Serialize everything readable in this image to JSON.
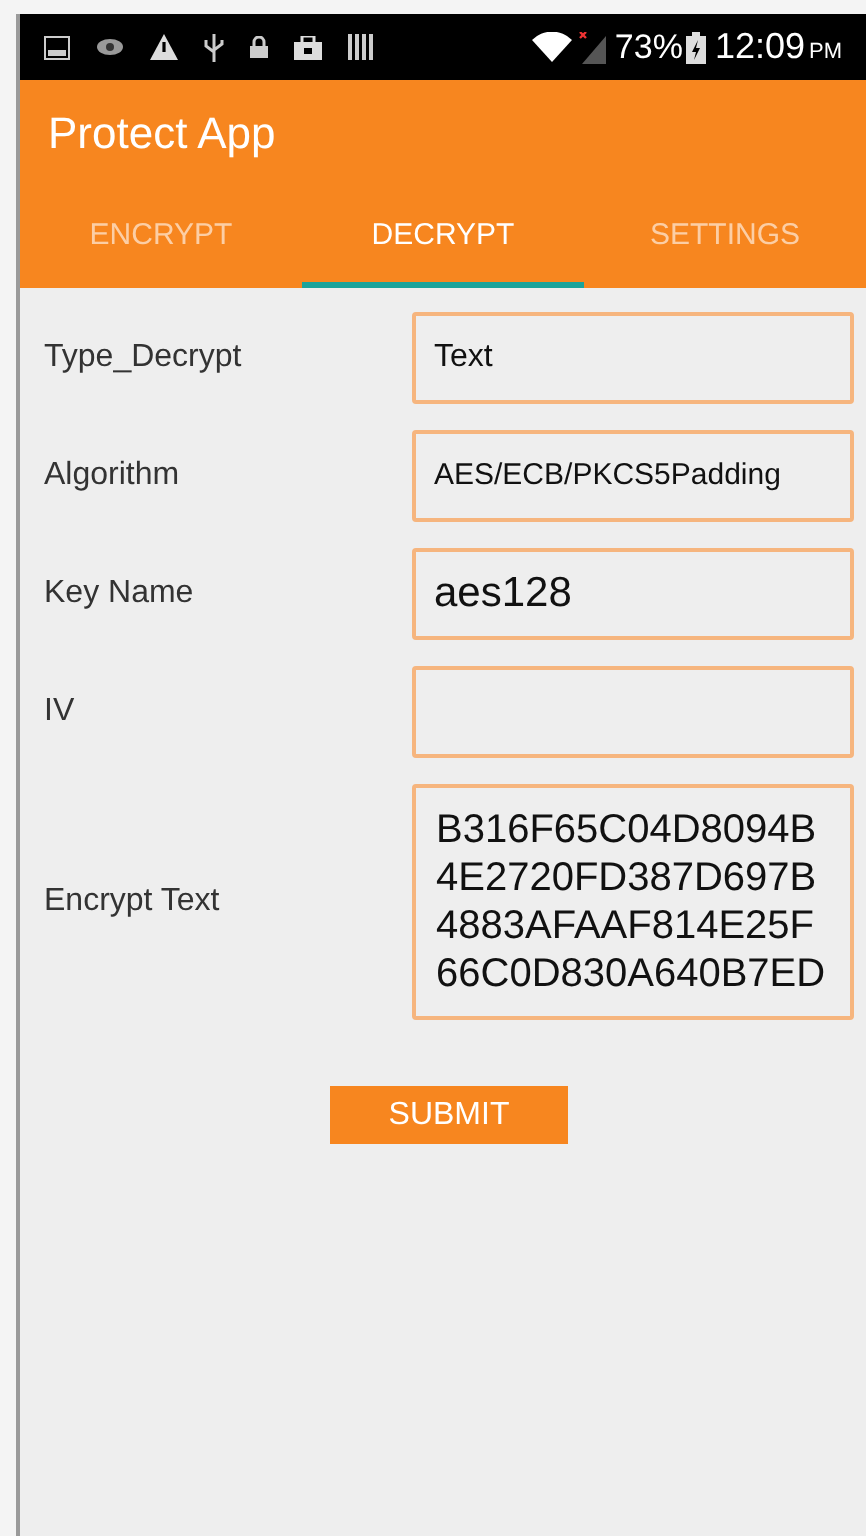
{
  "status_bar": {
    "battery": "73%",
    "time": "12:09",
    "time_suffix": "PM"
  },
  "app_bar": {
    "title": "Protect App"
  },
  "tabs": [
    {
      "label": "ENCRYPT",
      "selected": false
    },
    {
      "label": "DECRYPT",
      "selected": true
    },
    {
      "label": "SETTINGS",
      "selected": false
    }
  ],
  "form": {
    "rows": [
      {
        "label": "Type_Decrypt",
        "value": "Text",
        "kind": "normal"
      },
      {
        "label": "Algorithm",
        "value": "AES/ECB/PKCS5Padding",
        "kind": "small"
      },
      {
        "label": "Key Name",
        "value": "aes128",
        "kind": "large"
      },
      {
        "label": "IV",
        "kind": "normal"
      },
      {
        "label": "Encrypt Text",
        "value": "B316F65C04D8094B\n4E2720FD387D697B\n4883AFAAF814E25F\n66C0D830A640B7ED",
        "kind": "multiline"
      }
    ],
    "submit": "SUBMIT"
  }
}
